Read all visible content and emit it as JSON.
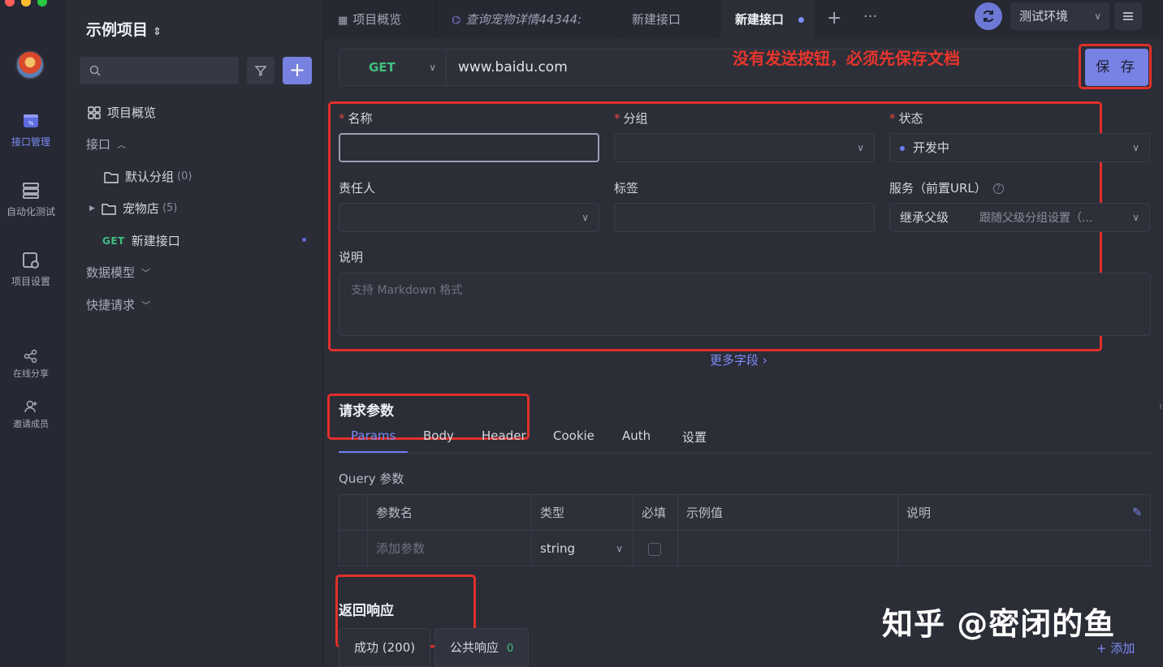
{
  "sidebar_rail": {
    "items": [
      {
        "label": "接口管理"
      },
      {
        "label": "自动化测试"
      },
      {
        "label": "项目设置"
      },
      {
        "label": "在线分享"
      },
      {
        "label": "邀请成员"
      }
    ]
  },
  "sidebar": {
    "project_title": "示例项目",
    "tree": {
      "overview": "项目概览",
      "interfaces": "接口",
      "default_group": "默认分组",
      "default_group_count": "(0)",
      "pet_store": "宠物店",
      "pet_store_count": "(5)",
      "new_api_method": "GET",
      "new_api_label": "新建接口",
      "data_models": "数据模型",
      "quick_requests": "快捷请求"
    }
  },
  "tabs": [
    {
      "label": "项目概览"
    },
    {
      "label": "查询宠物详情44344:"
    },
    {
      "label": "新建接口"
    },
    {
      "label": "新建接口"
    }
  ],
  "environment": {
    "selected": "测试环境"
  },
  "request": {
    "method": "GET",
    "url": "www.baidu.com",
    "save_label": "保 存"
  },
  "annotation": {
    "note": "没有发送按钮，必须先保存文档"
  },
  "form": {
    "name_label": "名称",
    "group_label": "分组",
    "status_label": "状态",
    "status_value": "开发中",
    "owner_label": "责任人",
    "tags_label": "标签",
    "service_label": "服务（前置URL）",
    "service_value": "继承父级",
    "service_hint": "跟随父级分组设置（...",
    "desc_label": "说明",
    "desc_placeholder": "支持 Markdown 格式",
    "more_fields": "更多字段 ›"
  },
  "params_section": {
    "title": "请求参数",
    "tabs": [
      "Params",
      "Body",
      "Header",
      "Cookie",
      "Auth",
      "设置"
    ],
    "query_label": "Query 参数",
    "columns": [
      "参数名",
      "类型",
      "必填",
      "示例值",
      "说明"
    ],
    "add_placeholder": "添加参数",
    "type_value": "string"
  },
  "response_section": {
    "title": "返回响应",
    "tabs": [
      {
        "label": "成功 (200)"
      },
      {
        "label": "公共响应",
        "badge": "0"
      }
    ],
    "add_label": "+ 添加"
  },
  "watermark": "知乎 @密闭的鱼",
  "colors": {
    "accent": "#7782e4",
    "get_method": "#3fbf7f",
    "annotation_red": "#e0302a"
  }
}
